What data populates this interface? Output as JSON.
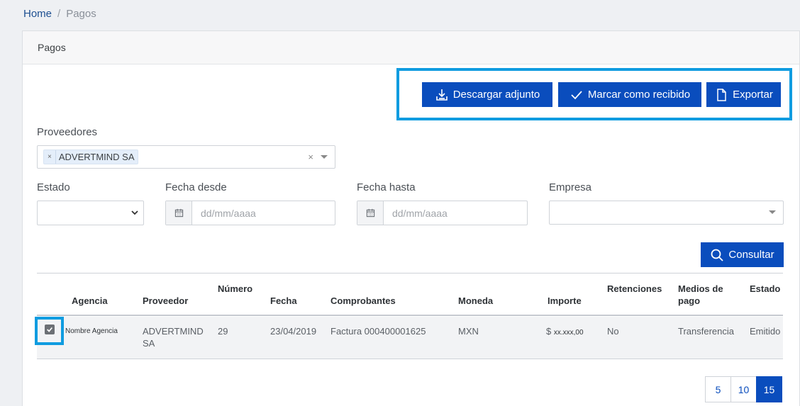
{
  "breadcrumb": {
    "home": "Home",
    "separator": "/",
    "current": "Pagos"
  },
  "card": {
    "title": "Pagos"
  },
  "actions": {
    "download_label": "Descargar adjunto",
    "mark_received_label": "Marcar como recibido",
    "export_label": "Exportar"
  },
  "filters": {
    "proveedores_label": "Proveedores",
    "proveedores_selected": "ADVERTMIND SA",
    "tag_remove": "×",
    "clear_symbol": "×",
    "estado_label": "Estado",
    "estado_value": "",
    "fecha_desde_label": "Fecha desde",
    "fecha_desde_placeholder": "dd/mm/aaaa",
    "fecha_hasta_label": "Fecha hasta",
    "fecha_hasta_placeholder": "dd/mm/aaaa",
    "empresa_label": "Empresa",
    "empresa_value": "",
    "consultar_label": "Consultar"
  },
  "table": {
    "headers": {
      "agencia": "Agencia",
      "proveedor": "Proveedor",
      "numero": "Número",
      "fecha": "Fecha",
      "comprobantes": "Comprobantes",
      "moneda": "Moneda",
      "importe": "Importe",
      "retenciones": "Retenciones",
      "medios_line1": "Medios de",
      "medios_line2": "pago",
      "estado": "Estado"
    },
    "rows": [
      {
        "checked": true,
        "agencia": "Nombre Agencia",
        "proveedor_line1": "ADVERTMIND",
        "proveedor_line2": "SA",
        "numero": "29",
        "fecha": "23/04/2019",
        "comprobantes": "Factura 000400001625",
        "moneda": "MXN",
        "importe_symbol": "$",
        "importe_value": "xx.xxx,00",
        "retenciones": "No",
        "medios": "Transferencia",
        "estado": "Emitido"
      }
    ]
  },
  "pagination": {
    "options": [
      "5",
      "10",
      "15"
    ],
    "selected": "15"
  },
  "colors": {
    "primary": "#0a4dbd",
    "highlight": "#109ce0"
  }
}
